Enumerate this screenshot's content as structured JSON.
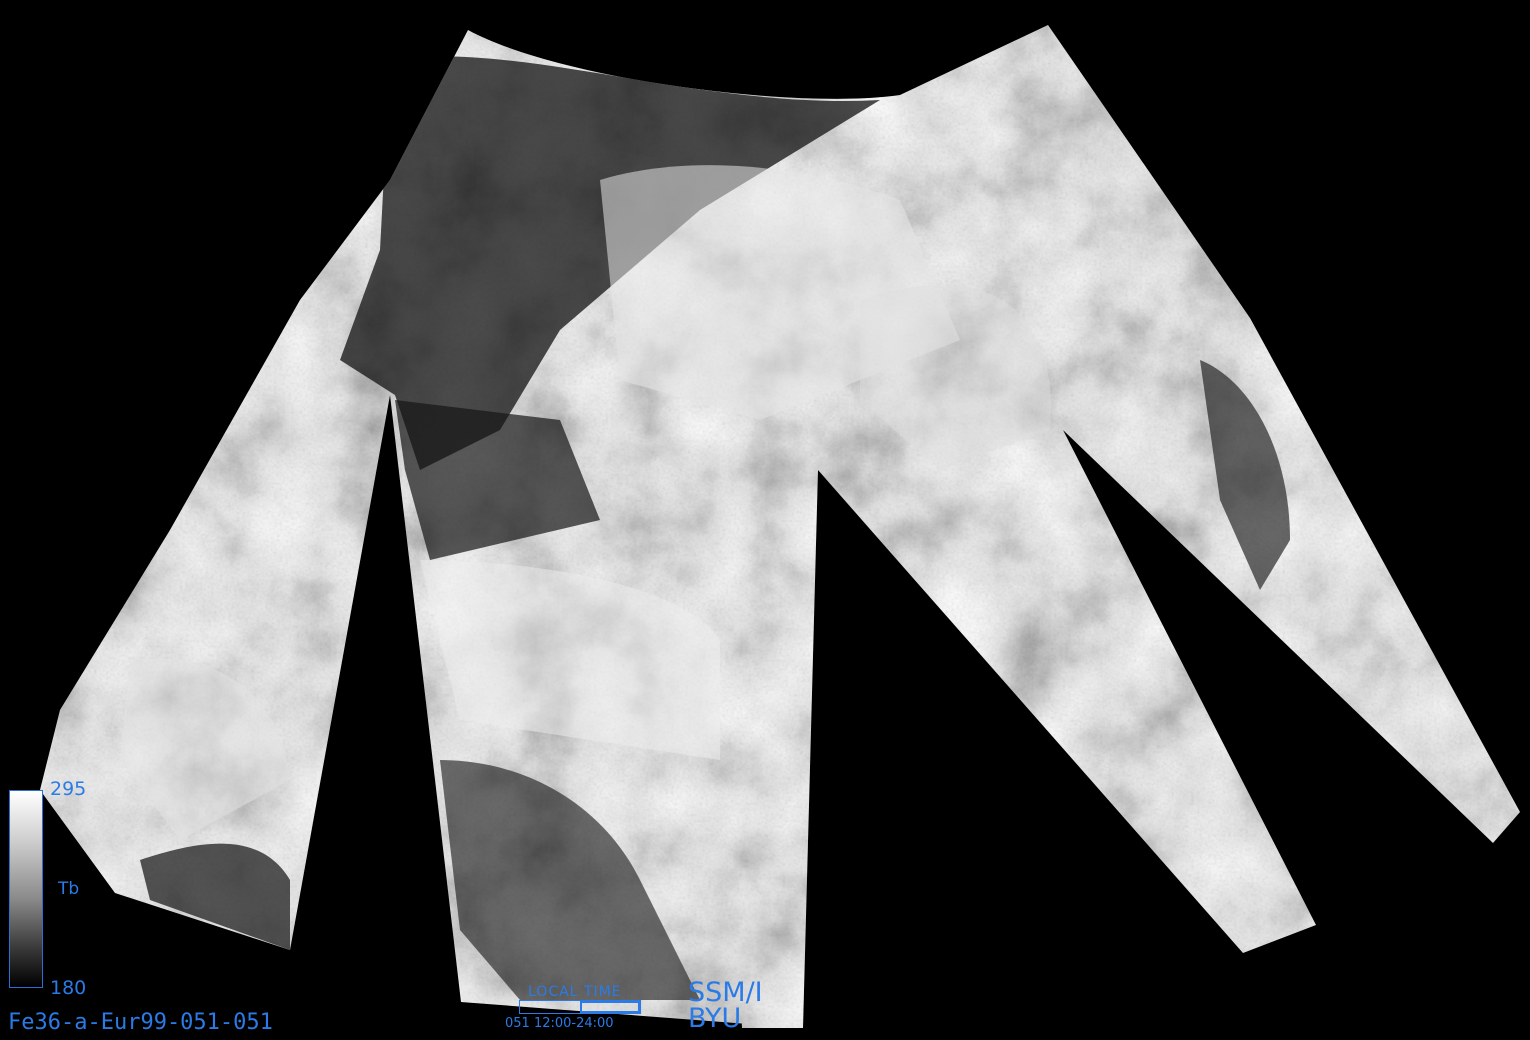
{
  "image": {
    "product_id": "Fe36-a-Eur99-051-051",
    "sensor": "SSM/I",
    "organization": "BYU"
  },
  "colorbar": {
    "max_label": "295",
    "min_label": "180",
    "quantity_label": "Tb"
  },
  "local_time": {
    "title": "LOCAL TIME",
    "range_text": "051  12:00-24:00",
    "start_fraction": 0.5,
    "end_fraction": 1.0
  },
  "colors": {
    "annotation": "#2a7be6",
    "background": "#000000"
  }
}
